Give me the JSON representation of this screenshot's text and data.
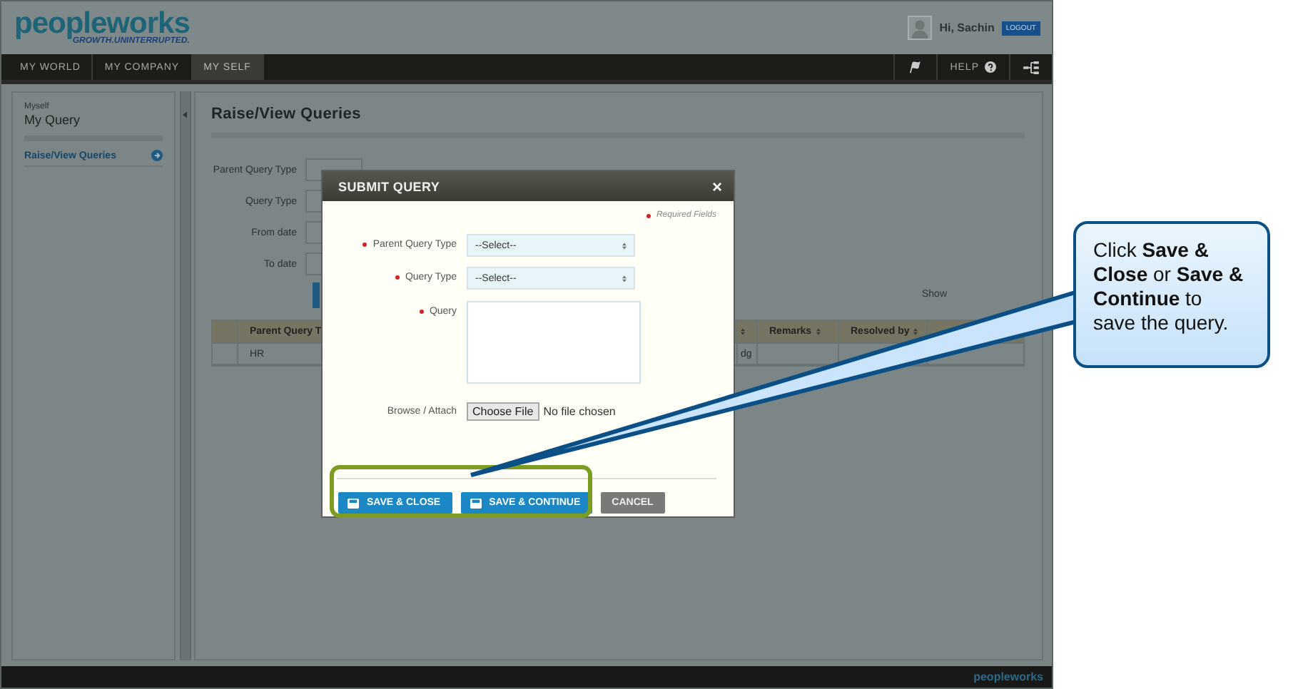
{
  "header": {
    "logo": "peopleworks",
    "tagline": "GROWTH.UNINTERRUPTED.",
    "greeting": "Hi, Sachin",
    "logout": "LOGOUT"
  },
  "nav": {
    "tabs": [
      {
        "label": "MY WORLD",
        "selected": false
      },
      {
        "label": "MY COMPANY",
        "selected": false
      },
      {
        "label": "MY SELF",
        "selected": true
      }
    ],
    "help": "HELP"
  },
  "sidebar": {
    "section": "Myself",
    "title": "My Query",
    "items": [
      {
        "label": "Raise/View Queries",
        "selected": true
      }
    ]
  },
  "page": {
    "title": "Raise/View Queries",
    "filters": [
      "Parent Query Type",
      "Query Type",
      "From date",
      "To date"
    ],
    "show_label": "Show",
    "table": {
      "columns": [
        "Parent Query T",
        "Remarks",
        "Resolved by"
      ],
      "rows": [
        {
          "cells": [
            "HR",
            "dg"
          ]
        }
      ]
    }
  },
  "dialog": {
    "title": "SUBMIT QUERY",
    "close": "×",
    "required_note": "Required Fields",
    "fields": [
      {
        "kind": "select",
        "label": "Parent Query Type",
        "required": true,
        "value": "--Select--"
      },
      {
        "kind": "select",
        "label": "Query Type",
        "required": true,
        "value": "--Select--"
      },
      {
        "kind": "textarea",
        "label": "Query",
        "required": true
      },
      {
        "kind": "file",
        "label": "Browse / Attach",
        "required": false,
        "button": "Choose File",
        "status": "No file chosen"
      }
    ],
    "buttons": [
      {
        "label": "SAVE & CLOSE",
        "kind": "save"
      },
      {
        "label": "SAVE & CONTINUE",
        "kind": "save"
      },
      {
        "label": "CANCEL",
        "kind": "cancel"
      }
    ]
  },
  "callout": {
    "text": "Click **Save & Close** or **Save & Continue** to save the query."
  },
  "footer": {
    "brand": "peopleworks"
  }
}
